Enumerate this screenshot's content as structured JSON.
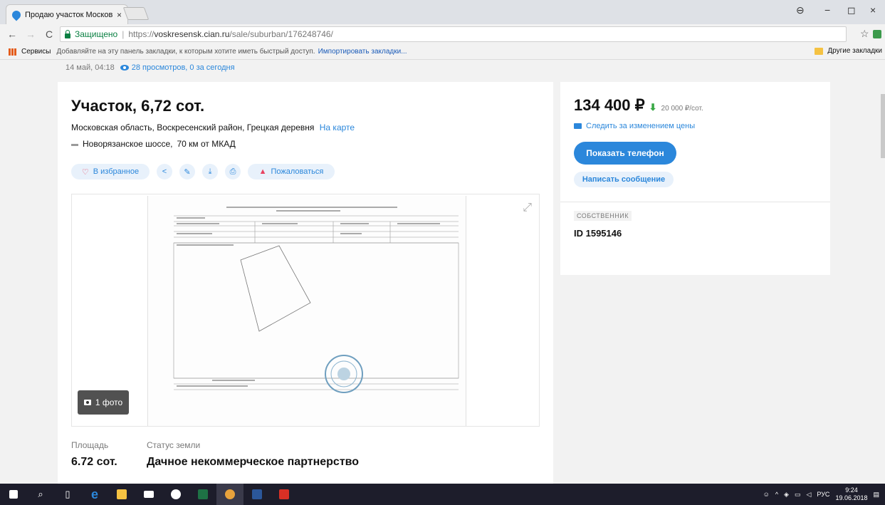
{
  "browser": {
    "tab_title": "Продаю участок Москов",
    "tab_close": "×",
    "url_secure": "Защищено",
    "url_prefix": "https://",
    "url_host": "voskresensk.cian.ru",
    "url_path": "/sale/suburban/176248746/",
    "nav_back": "←",
    "nav_forward": "→",
    "nav_reload": "C",
    "star": "☆",
    "menu": "⋮",
    "profile": "⊖",
    "minimize": "−",
    "maximize": "◻",
    "close": "×"
  },
  "bookmarks": {
    "services": "Сервисы",
    "hint": "Добавляйте на эту панель закладки, к которым хотите иметь быстрый доступ.",
    "import_link": "Импортировать закладки...",
    "other": "Другие закладки"
  },
  "listing": {
    "date": "14 май, 04:18",
    "views": "28 просмотров, 0 за сегодня",
    "title": "Участок, 6,72 сот.",
    "address": "Московская область, Воскресенский район, Грецкая деревня",
    "map_link": "На карте",
    "highway": "Новорязанское шоссе,",
    "highway_distance": "70 км от МКАД",
    "favorite": "В избранное",
    "complain": "Пожаловаться",
    "photo_count": "1 фото",
    "area_label": "Площадь",
    "area_value": "6.72 сот.",
    "land_status_label": "Статус земли",
    "land_status_value": "Дачное некоммерческое партнерство"
  },
  "sidebar": {
    "price": "134 400 ₽",
    "price_per": "20 000 ₽/сот.",
    "follow_price": "Следить за изменением цены",
    "show_phone": "Показать телефон",
    "write_message": "Написать сообщение",
    "owner_tag": "СОБСТВЕННИК",
    "owner_id": "ID 1595146"
  },
  "taskbar": {
    "lang": "РУС",
    "time": "9:24",
    "date": "19.06.2018"
  },
  "colors": {
    "accent": "#2b87db",
    "accent_light": "#e8f1fb",
    "danger": "#e84260",
    "price_down": "#38a845"
  }
}
